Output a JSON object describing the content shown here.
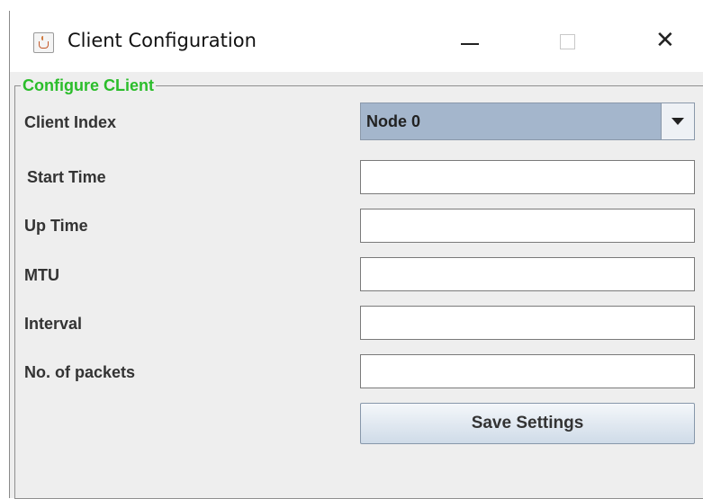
{
  "window": {
    "title": "Client Configuration",
    "app_icon": "java-cup-icon",
    "minimize_glyph": "",
    "maximize_glyph": "",
    "close_glyph": "✕"
  },
  "group": {
    "title": "Configure CLient",
    "title_color": "#2bbd2b"
  },
  "form": {
    "client_index": {
      "label": "Client Index",
      "selected": "Node 0"
    },
    "start_time": {
      "label": "Start Time",
      "value": ""
    },
    "up_time": {
      "label": "Up Time",
      "value": ""
    },
    "mtu": {
      "label": "MTU",
      "value": ""
    },
    "interval": {
      "label": "Interval",
      "value": ""
    },
    "packets": {
      "label": "No. of packets",
      "value": ""
    }
  },
  "actions": {
    "save_label": "Save Settings"
  }
}
